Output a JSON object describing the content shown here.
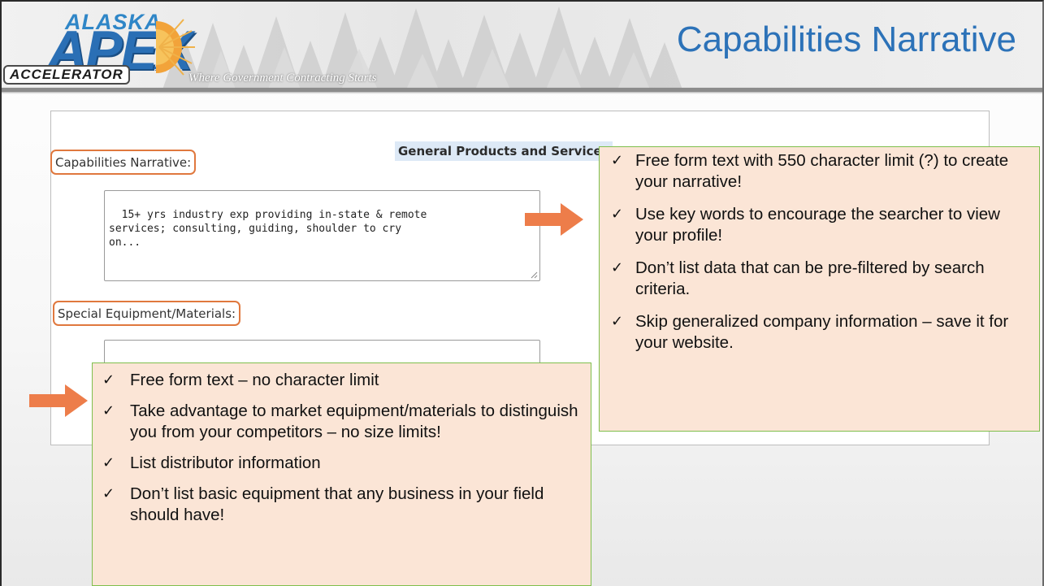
{
  "header": {
    "logo_top": "ALASKA",
    "logo_main": "APEX",
    "logo_bottom": "ACCELERATOR",
    "tagline": "Where Government Contracting Starts",
    "title": "Capabilities Narrative"
  },
  "form": {
    "section_heading": "General Products and Services",
    "capabilities_label": "Capabilities Narrative:",
    "capabilities_value": "15+ yrs industry exp providing in-state & remote\nservices; consulting, guiding, shoulder to cry\non...",
    "equipment_label": "Special Equipment/Materials:",
    "equipment_value": ""
  },
  "callout_right": {
    "items": [
      "Free form text  with 550 character limit (?) to create your narrative!",
      "Use key words to encourage the searcher to view your profile!",
      "Don’t list data that can be pre-filtered by search criteria.",
      "Skip generalized company information – save it for your website."
    ]
  },
  "callout_left": {
    "items": [
      "Free form text – no character limit",
      "Take advantage to market equipment/materials to distinguish you from your competitors – no size limits!",
      "List distributor information",
      "Don’t list basic equipment that any business in your field should have!"
    ]
  },
  "glyphs": {
    "check": "✓"
  },
  "colors": {
    "title": "#2c72b8",
    "label_outline": "#e0783e",
    "arrow": "#ed7d4a",
    "callout_fill": "#fbe5d6",
    "callout_border": "#7fbf4d",
    "heading_highlight": "#dde9f6"
  }
}
